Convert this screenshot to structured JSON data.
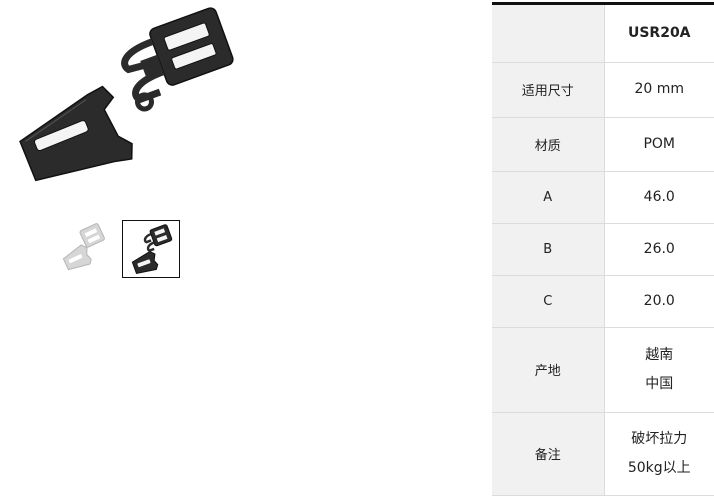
{
  "gallery": {
    "main_image": "buckle-black-photo",
    "thumbnails": [
      {
        "icon": "buckle-white-thumbnail",
        "selected": false
      },
      {
        "icon": "buckle-black-thumbnail",
        "selected": true
      }
    ]
  },
  "spec_table": {
    "model": "USR20A",
    "rows": [
      {
        "label": "适用尺寸",
        "value_lines": [
          "20 mm"
        ]
      },
      {
        "label": "材质",
        "value_lines": [
          "POM"
        ]
      },
      {
        "label": "A",
        "value_lines": [
          "46.0"
        ]
      },
      {
        "label": "B",
        "value_lines": [
          "26.0"
        ]
      },
      {
        "label": "C",
        "value_lines": [
          "20.0"
        ]
      },
      {
        "label": "产地",
        "value_lines": [
          "越南",
          "中国"
        ]
      },
      {
        "label": "备注",
        "value_lines": [
          "破坏拉力",
          "50kg以上"
        ]
      }
    ]
  },
  "colors": {
    "header_rule": "#111111",
    "label_cell_bg": "#f1f1f1",
    "border": "#dcdcdc",
    "buckle_black": "#2b2b2b",
    "buckle_white": "#d6d6d6"
  }
}
